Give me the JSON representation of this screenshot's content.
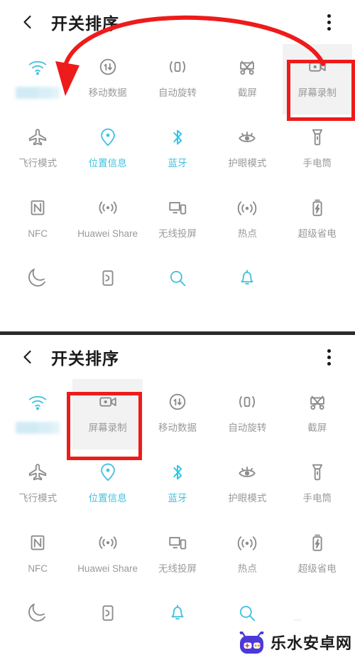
{
  "colors": {
    "accent_cyan": "#45c2dd",
    "bluetooth_cyan": "#29c5e8",
    "label_gray": "#9a9a9a",
    "icon_gray": "#8c8c8c",
    "annotation_red": "#ee1b1b",
    "title_black": "#1a1a1a",
    "selected_tile": "#f2f2f2",
    "watermark_purple": "#4b39d8"
  },
  "panel_top": {
    "header": {
      "back_icon": "arrow-left-icon",
      "title": "开关排序",
      "menu_icon": "more-vertical-icon"
    },
    "tiles": [
      {
        "label": "",
        "icon": "wifi-icon",
        "state": "on",
        "blurred_label": true
      },
      {
        "label": "移动数据",
        "icon": "mobile-data-icon",
        "state": "off"
      },
      {
        "label": "自动旋转",
        "icon": "auto-rotate-icon",
        "state": "off"
      },
      {
        "label": "截屏",
        "icon": "screenshot-icon",
        "state": "off"
      },
      {
        "label": "屏幕录制",
        "icon": "screen-record-icon",
        "state": "off",
        "selected": true
      },
      {
        "label": "飞行模式",
        "icon": "airplane-icon",
        "state": "off"
      },
      {
        "label": "位置信息",
        "icon": "location-icon",
        "state": "on"
      },
      {
        "label": "蓝牙",
        "icon": "bluetooth-icon",
        "state": "on"
      },
      {
        "label": "护眼模式",
        "icon": "eye-comfort-icon",
        "state": "off"
      },
      {
        "label": "手电筒",
        "icon": "flashlight-icon",
        "state": "off"
      },
      {
        "label": "NFC",
        "icon": "nfc-icon",
        "state": "off"
      },
      {
        "label": "Huawei Share",
        "icon": "huawei-share-icon",
        "state": "off"
      },
      {
        "label": "无线投屏",
        "icon": "wireless-projection-icon",
        "state": "off"
      },
      {
        "label": "热点",
        "icon": "hotspot-icon",
        "state": "off"
      },
      {
        "label": "超级省电",
        "icon": "ultra-power-saving-icon",
        "state": "off"
      },
      {
        "label": "",
        "icon": "do-not-disturb-icon",
        "state": "off"
      },
      {
        "label": "",
        "icon": "smart-card-icon",
        "state": "off"
      },
      {
        "label": "",
        "icon": "search-icon",
        "state": "on"
      },
      {
        "label": "",
        "icon": "bell-icon",
        "state": "on"
      },
      {
        "label": "",
        "icon": "blank-icon",
        "state": "blank"
      }
    ],
    "annotation": {
      "highlight_tile_label": "屏幕录制",
      "arrow": "curved-drag-arrow"
    }
  },
  "panel_bottom": {
    "header": {
      "back_icon": "arrow-left-icon",
      "title": "开关排序",
      "menu_icon": "more-vertical-icon"
    },
    "tiles": [
      {
        "label": "",
        "icon": "wifi-icon",
        "state": "on",
        "blurred_label": true
      },
      {
        "label": "屏幕录制",
        "icon": "screen-record-icon",
        "state": "off",
        "selected": true
      },
      {
        "label": "移动数据",
        "icon": "mobile-data-icon",
        "state": "off"
      },
      {
        "label": "自动旋转",
        "icon": "auto-rotate-icon",
        "state": "off"
      },
      {
        "label": "截屏",
        "icon": "screenshot-icon",
        "state": "off"
      },
      {
        "label": "飞行模式",
        "icon": "airplane-icon",
        "state": "off"
      },
      {
        "label": "位置信息",
        "icon": "location-icon",
        "state": "on"
      },
      {
        "label": "蓝牙",
        "icon": "bluetooth-icon",
        "state": "on"
      },
      {
        "label": "护眼模式",
        "icon": "eye-comfort-icon",
        "state": "off"
      },
      {
        "label": "手电筒",
        "icon": "flashlight-icon",
        "state": "off"
      },
      {
        "label": "NFC",
        "icon": "nfc-icon",
        "state": "off"
      },
      {
        "label": "Huawei Share",
        "icon": "huawei-share-icon",
        "state": "off"
      },
      {
        "label": "无线投屏",
        "icon": "wireless-projection-icon",
        "state": "off"
      },
      {
        "label": "热点",
        "icon": "hotspot-icon",
        "state": "off"
      },
      {
        "label": "超级省电",
        "icon": "ultra-power-saving-icon",
        "state": "off"
      },
      {
        "label": "",
        "icon": "do-not-disturb-icon",
        "state": "off"
      },
      {
        "label": "",
        "icon": "smart-card-icon",
        "state": "off"
      },
      {
        "label": "",
        "icon": "bell-icon",
        "state": "on"
      },
      {
        "label": "",
        "icon": "search-icon",
        "state": "on"
      },
      {
        "label": "",
        "icon": "blank-icon",
        "state": "blank"
      }
    ],
    "annotation": {
      "highlight_tile_label": "屏幕录制"
    }
  },
  "watermark": {
    "text": "乐水安卓网",
    "icon": "robot-logo-icon"
  }
}
